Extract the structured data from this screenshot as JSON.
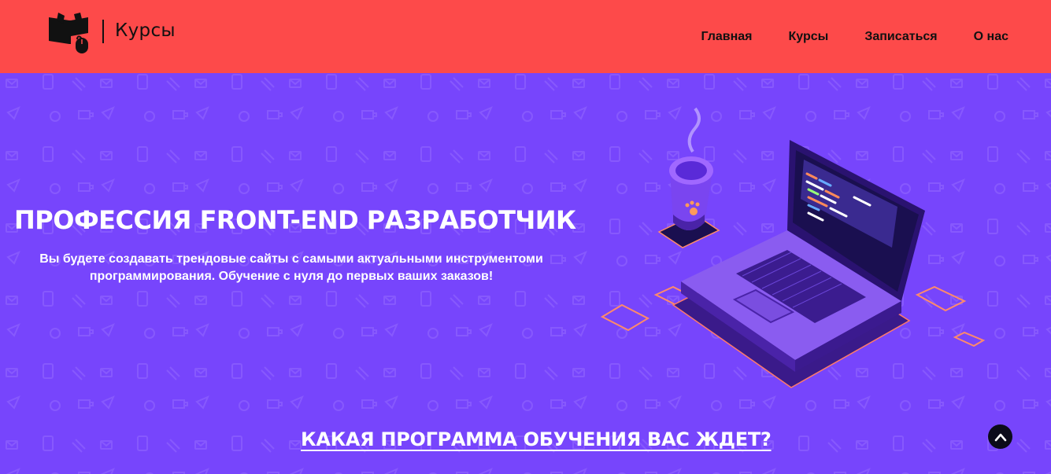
{
  "header": {
    "logo_text": "Курсы",
    "logo_icon": "book-mouse-icon",
    "nav": [
      {
        "label": "Главная"
      },
      {
        "label": "Курсы"
      },
      {
        "label": "Записаться"
      },
      {
        "label": "О нас"
      }
    ]
  },
  "hero": {
    "title": "ПРОФЕССИЯ FRONT-END РАЗРАБОТЧИК",
    "subtitle_line1": "Вы будете создавать трендовые сайты с самыми актуальными инструментоми",
    "subtitle_line2": "программирования. Обучение с нуля до первых ваших заказов!",
    "illustration": "laptop-coffee-illustration"
  },
  "program_link": "КАКАЯ ПРОГРАММА ОБУЧЕНИЯ ВАС ЖДЕТ?",
  "scroll_top_icon": "chevron-up-icon",
  "colors": {
    "header_bg": "#fd4a4a",
    "hero_bg": "#7745fc",
    "text_dark": "#111111",
    "text_light": "#ffffff"
  }
}
